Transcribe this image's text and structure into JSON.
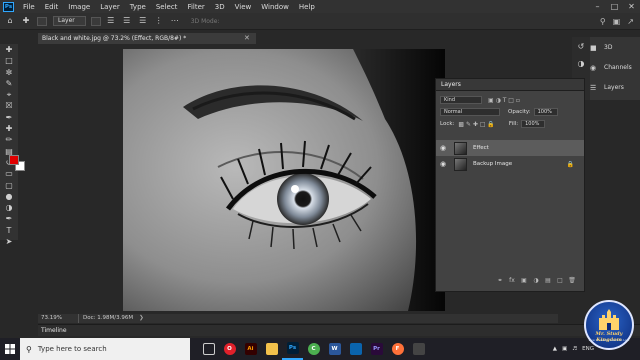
{
  "app": {
    "logo_text": "Ps",
    "menu": [
      "File",
      "Edit",
      "Image",
      "Layer",
      "Type",
      "Select",
      "Filter",
      "3D",
      "View",
      "Window",
      "Help"
    ]
  },
  "options_bar": {
    "auto_select_value": "Layer",
    "mode_3d_label": "3D Mode:"
  },
  "document": {
    "tab_title": "Black and white.jpg @ 73.2% (Effect, RGB/8#) *",
    "zoom": "73.19%",
    "doc_info": "Doc: 1.98M/3.96M"
  },
  "layers_panel": {
    "title": "Layers",
    "filter_kind": "Kind",
    "blend_mode": "Normal",
    "opacity_label": "Opacity:",
    "opacity_value": "100%",
    "lock_label": "Lock:",
    "fill_label": "Fill:",
    "fill_value": "100%",
    "layers": [
      {
        "name": "Effect",
        "selected": true
      },
      {
        "name": "Backup Image",
        "selected": false
      }
    ]
  },
  "dock": {
    "items": [
      "3D",
      "Channels",
      "Layers"
    ]
  },
  "timeline": {
    "label": "Timeline"
  },
  "taskbar": {
    "search_placeholder": "Type here to search",
    "language": "ENG",
    "apps": [
      {
        "name": "opera",
        "label": "O",
        "color": "#e0202a"
      },
      {
        "name": "illustrator",
        "label": "Ai",
        "color": "#ff7c00"
      },
      {
        "name": "photoshop",
        "label": "Ps",
        "color": "#31a8ff"
      },
      {
        "name": "chrome",
        "label": "C",
        "color": "#4caf50"
      },
      {
        "name": "word",
        "label": "W",
        "color": "#2b579a"
      },
      {
        "name": "premiere",
        "label": "Pr",
        "color": "#9999ff"
      },
      {
        "name": "firefox",
        "label": "F",
        "color": "#ff7139"
      }
    ]
  },
  "watermark": {
    "line1": "Mr. Study Kingdom",
    "line2": "Live to Learn, Learn to Live"
  },
  "colors": {
    "foreground": "#e00000",
    "background": "#ffffff",
    "accent": "#31a8ff"
  }
}
